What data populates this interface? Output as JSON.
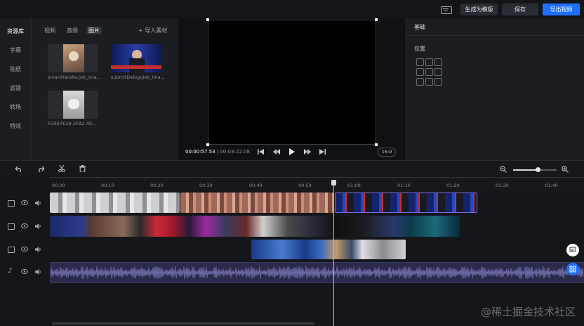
{
  "topbar": {
    "keyboard_icon": "keyboard-icon",
    "template_label": "生成为模版",
    "save_label": "保存",
    "export_label": "导出视频"
  },
  "leftnav": {
    "items": [
      {
        "label": "资源库",
        "active": true
      },
      {
        "label": "字幕",
        "active": false
      },
      {
        "label": "贴纸",
        "active": false
      },
      {
        "label": "滤镜",
        "active": false
      },
      {
        "label": "转场",
        "active": false
      },
      {
        "label": "特效",
        "active": false
      }
    ]
  },
  "resources": {
    "tabs": [
      {
        "label": "视频",
        "active": false
      },
      {
        "label": "音频",
        "active": false
      },
      {
        "label": "图片",
        "active": true
      }
    ],
    "import_label": "导入素材",
    "items": [
      {
        "caption": "smartHandle.Job_ima..."
      },
      {
        "caption": "submitDelogoJob_ima..."
      },
      {
        "caption": "FD587E29-2FB2-40..."
      }
    ]
  },
  "player": {
    "current_time": "00:00:57.53",
    "total_time": "/ 00:03:22.08",
    "aspect_ratio": "16:9"
  },
  "rightpanel": {
    "section_title": "基础",
    "position_label": "位置"
  },
  "timeline": {
    "ruler": [
      "00:00",
      "00:10",
      "00:20",
      "00:30",
      "00:40",
      "00:50",
      "01:00",
      "01:10",
      "01:20",
      "01:30",
      "01:40"
    ],
    "zoom_level": 0.58,
    "playhead_time": "00:57"
  },
  "watermark": "@稀土掘金技术社区",
  "colors": {
    "accent": "#1f6fff",
    "clip_border": "#7b6be0",
    "audio_wave": "#6b6aa6",
    "audio_bg": "#2a2a4a"
  }
}
